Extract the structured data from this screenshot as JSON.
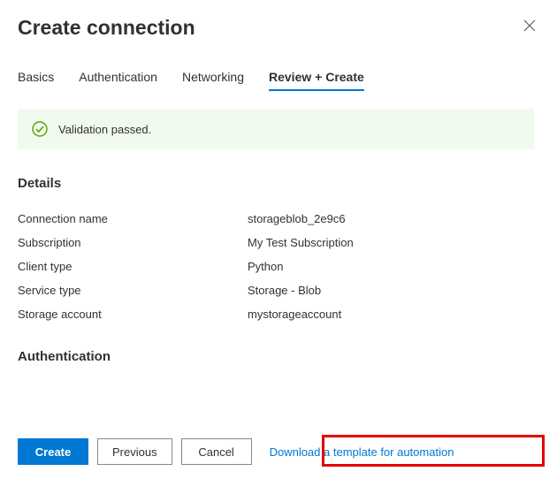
{
  "header": {
    "title": "Create connection"
  },
  "tabs": {
    "basics": "Basics",
    "authentication": "Authentication",
    "networking": "Networking",
    "review": "Review + Create"
  },
  "validation": {
    "message": "Validation passed."
  },
  "sections": {
    "details_title": "Details",
    "authentication_title": "Authentication"
  },
  "details": {
    "connection_name_label": "Connection name",
    "connection_name_value": "storageblob_2e9c6",
    "subscription_label": "Subscription",
    "subscription_value": "My Test Subscription",
    "client_type_label": "Client type",
    "client_type_value": "Python",
    "service_type_label": "Service type",
    "service_type_value": "Storage - Blob",
    "storage_account_label": "Storage account",
    "storage_account_value": "mystorageaccount"
  },
  "footer": {
    "create": "Create",
    "previous": "Previous",
    "cancel": "Cancel",
    "download_template": "Download a template for automation"
  }
}
